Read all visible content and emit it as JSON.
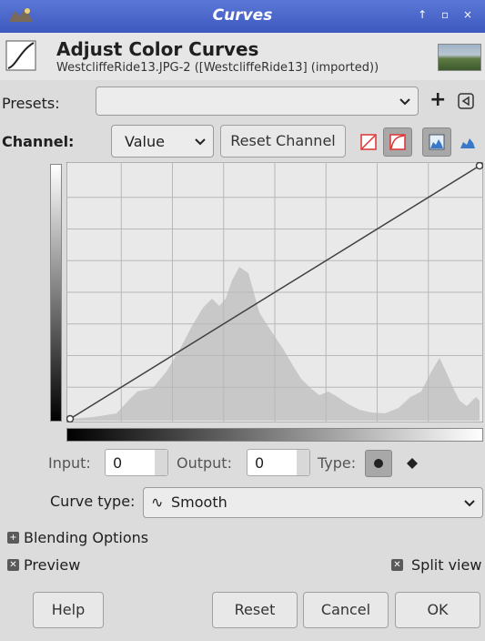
{
  "window": {
    "title": "Curves",
    "controls": "↑ ▫ ×"
  },
  "header": {
    "title": "Adjust Color Curves",
    "subtitle": "WestcliffeRide13.JPG-2 ([WestcliffeRide13] (imported))"
  },
  "presets": {
    "label": "Presets:",
    "value": "",
    "add_glyph": "+"
  },
  "channel": {
    "label": "Channel:",
    "value": "Value",
    "reset_label": "Reset Channel"
  },
  "curve": {
    "points": [
      [
        0,
        0
      ],
      [
        255,
        255
      ]
    ]
  },
  "point": {
    "input_label": "Input:",
    "input_value": "0",
    "output_label": "Output:",
    "output_value": "0",
    "type_label": "Type:"
  },
  "curve_type": {
    "label": "Curve type:",
    "value": "Smooth",
    "glyph": "∿"
  },
  "blending": {
    "label": "Blending Options",
    "expanded": false
  },
  "preview": {
    "label": "Preview",
    "checked": true
  },
  "split_view": {
    "label": "Split view",
    "checked": true
  },
  "buttons": {
    "help": "Help",
    "reset": "Reset",
    "cancel": "Cancel",
    "ok": "OK"
  },
  "colors": {
    "titlebar": "#4a66cc",
    "histogram": "#c8c8c8",
    "grid": "#b8b8b8",
    "curve": "#404040"
  }
}
